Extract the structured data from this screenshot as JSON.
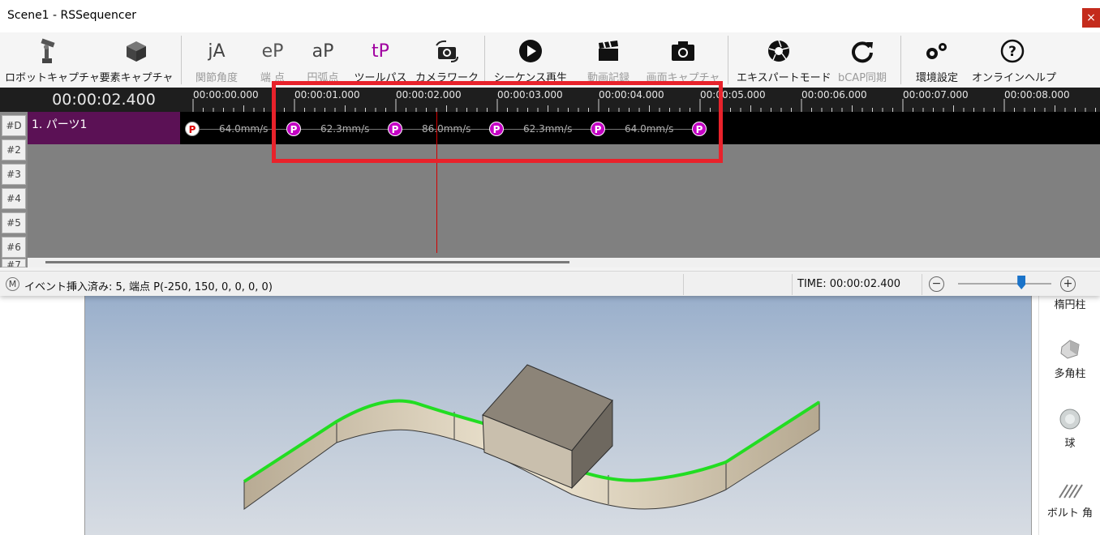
{
  "window": {
    "title": "Scene1 - RSSequencer",
    "close_symbol": "×"
  },
  "toolbar": {
    "items": [
      {
        "label": "ロボットキャプチャ",
        "icon": "robot-arm-icon",
        "enabled": true
      },
      {
        "label": "要素キャプチャ",
        "icon": "cube-icon",
        "enabled": true
      },
      {
        "label": "関節角度",
        "icon_text": "jA",
        "enabled": false
      },
      {
        "label": "端 点",
        "icon_text": "eP",
        "enabled": false
      },
      {
        "label": "円弧点",
        "icon_text": "aP",
        "enabled": false
      },
      {
        "label": "ツールパス",
        "icon_text": "tP",
        "enabled": true
      },
      {
        "label": "カメラワーク",
        "icon": "camera-rotate-icon",
        "enabled": true
      },
      {
        "label": "シーケンス再生",
        "icon": "play-icon",
        "enabled": true
      },
      {
        "label": "動画記録",
        "icon": "clapperboard-icon",
        "enabled": false
      },
      {
        "label": "画面キャプチャ",
        "icon": "camera-icon",
        "enabled": false
      },
      {
        "label": "エキスパートモード",
        "icon": "aperture-icon",
        "enabled": true
      },
      {
        "label": "bCAP同期",
        "icon": "sync-icon",
        "enabled": false
      },
      {
        "label": "環境設定",
        "icon": "gears-icon",
        "enabled": true
      },
      {
        "label": "オンラインヘルプ",
        "icon": "help-icon",
        "enabled": true
      }
    ]
  },
  "timeline": {
    "current_time": "00:00:02.400",
    "ruler_labels": [
      "00:00:00.000",
      "00:00:01.000",
      "00:00:02.000",
      "00:00:03.000",
      "00:00:04.000",
      "00:00:05.000",
      "00:00:06.000",
      "00:00:07.000",
      "00:00:08.000"
    ],
    "row_labels": [
      "#D",
      "#2",
      "#3",
      "#4",
      "#5",
      "#6",
      "#7"
    ],
    "track1": {
      "name": "1. パーツ1",
      "events": [
        "P",
        "P",
        "P",
        "P",
        "P",
        "P"
      ],
      "speeds": [
        "64.0mm/s",
        "62.3mm/s",
        "86.0mm/s",
        "62.3mm/s",
        "64.0mm/s"
      ]
    }
  },
  "status": {
    "mode_icon": "M",
    "message": "イベント挿入済み: 5, 端点 P(-250, 150, 0, 0, 0, 0)",
    "time": "TIME: 00:00:02.400",
    "zoom_minus": "−",
    "zoom_plus": "+",
    "zoom_level": 0.68
  },
  "right_panel": {
    "items": [
      {
        "label": "楕円柱",
        "icon": "ellipse-cylinder-icon"
      },
      {
        "label": "多角柱",
        "icon": "polygon-prism-icon"
      },
      {
        "label": "球",
        "icon": "sphere-icon"
      },
      {
        "label": "ボルト 角",
        "icon": "bolt-icon"
      }
    ]
  },
  "colors": {
    "highlight": "#e8222b",
    "event_marker": "#c400c4",
    "track_name_bg": "#5b1155",
    "playhead": "#d20000",
    "toolpath": "#22dd22",
    "zoom_thumb": "#1a73c9"
  }
}
